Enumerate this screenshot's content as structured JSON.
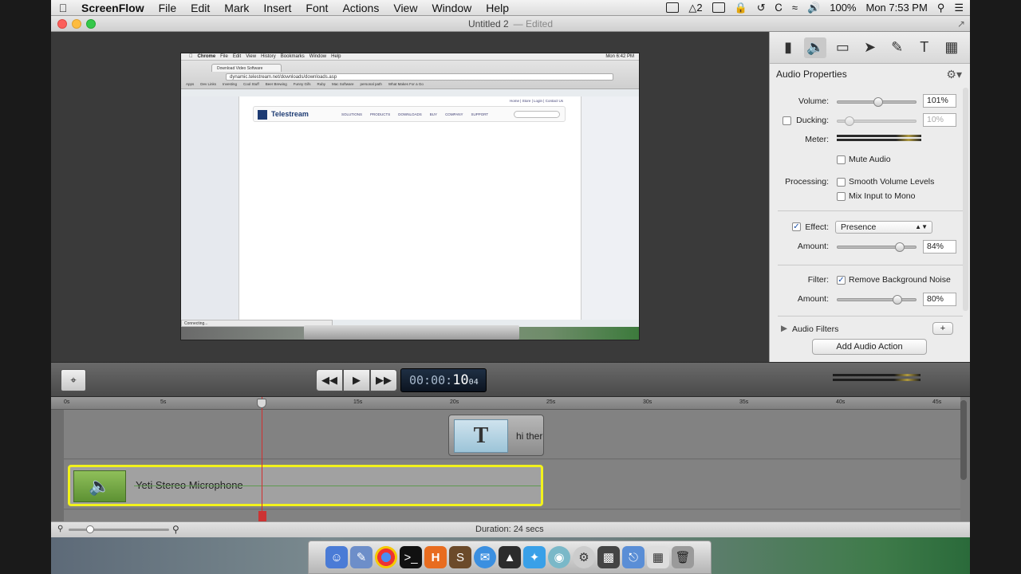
{
  "menubar": {
    "app": "ScreenFlow",
    "items": [
      "File",
      "Edit",
      "Mark",
      "Insert",
      "Font",
      "Actions",
      "View",
      "Window",
      "Help"
    ],
    "tray_count": "2",
    "battery": "100%",
    "clock": "Mon 7:53 PM"
  },
  "window": {
    "title": "Untitled 2",
    "status": "— Edited"
  },
  "preview": {
    "menubar_app": "Chrome",
    "menubar_items": [
      "File",
      "Edit",
      "View",
      "History",
      "Bookmarks",
      "Window",
      "Help"
    ],
    "menubar_clock": "Mon 6:42 PM",
    "tab_title": "Download Video Software",
    "url": "dynamic.telestream.net/downloads/downloads.asp",
    "bookmarks": [
      "Apps",
      "Dev Links",
      "Investing",
      "Cool Stuff",
      "Beer Brewing",
      "Funny Gifs",
      "Ruby",
      "Mac Software",
      "personal path",
      "What Makes For a Go"
    ],
    "toplinks": "Home | Store | Login | Contact Us",
    "logo": "Telestream",
    "nav": [
      "SOLUTIONS",
      "PRODUCTS",
      "DOWNLOADS",
      "BUY",
      "COMPANY",
      "SUPPORT"
    ],
    "status": "Connecting..."
  },
  "panel": {
    "title": "Audio Properties",
    "volume_label": "Volume:",
    "volume_value": "101%",
    "volume_level": 0.52,
    "ducking_label": "Ducking:",
    "ducking_value": "10%",
    "ducking_level": 0.1,
    "meter_label": "Meter:",
    "mute_label": "Mute Audio",
    "processing_label": "Processing:",
    "smooth_label": "Smooth Volume Levels",
    "mono_label": "Mix Input to Mono",
    "effect_label": "Effect:",
    "effect_value": "Presence",
    "effect_amount_label": "Amount:",
    "effect_amount_value": "84%",
    "effect_amount_level": 0.84,
    "filter_label": "Filter:",
    "filter_name": "Remove Background Noise",
    "filter_amount_label": "Amount:",
    "filter_amount_value": "80%",
    "filter_amount_level": 0.8,
    "audio_filters_label": "Audio Filters",
    "add_action_label": "Add Audio Action"
  },
  "transport": {
    "timecode_dim": "00:00:",
    "timecode_sec": "10",
    "timecode_frames": "04"
  },
  "timeline": {
    "ticks": [
      "0s",
      "5s",
      "10s",
      "15s",
      "20s",
      "25s",
      "30s",
      "35s",
      "40s",
      "45s"
    ],
    "text_clip_label": "hi there",
    "audio_clip_label": "Yeti Stereo Microphone"
  },
  "status": {
    "duration": "Duration: 24 secs"
  }
}
